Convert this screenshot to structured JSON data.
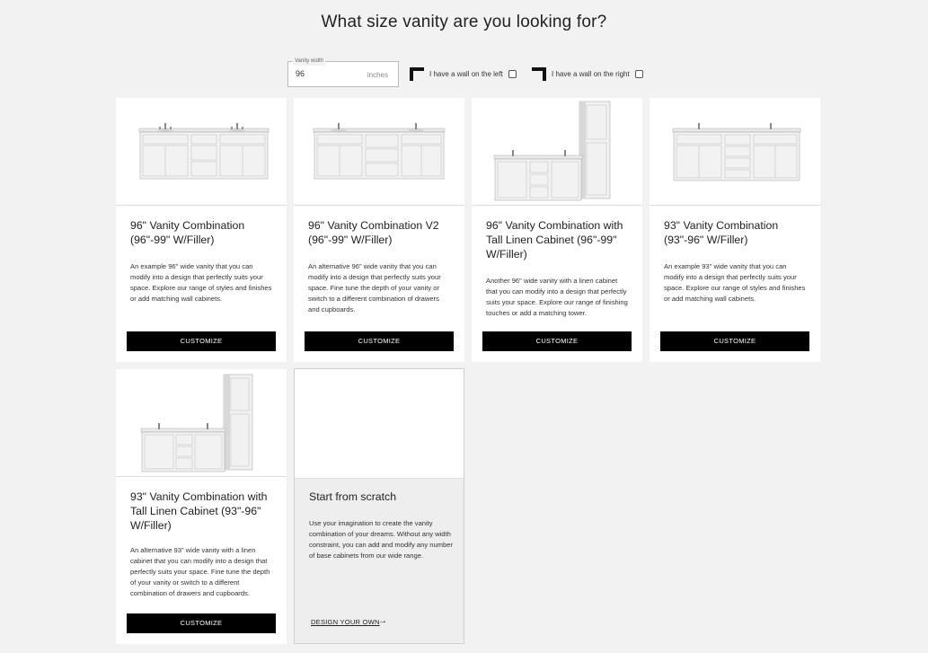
{
  "page": {
    "title": "What size vanity are you looking for?"
  },
  "controls": {
    "width_label": "Vanity width",
    "width_value": "96",
    "width_unit": "inches",
    "wall_left_label": "I have a wall on the left",
    "wall_left_checked": false,
    "wall_right_label": "I have a wall on the right",
    "wall_right_checked": false
  },
  "cards": [
    {
      "title": "96\" Vanity Combination (96\"-99\" W/Filler)",
      "description": "An example 96\" wide vanity that you can modify into a design that perfectly suits your space. Explore our range of styles and finishes or add matching wall cabinets.",
      "button": "CUSTOMIZE",
      "image": "double-vanity-image"
    },
    {
      "title": "96\" Vanity Combination V2 (96\"-99\" W/Filler)",
      "description": "An alternative 96\" wide vanity that you can modify into a design that perfectly suits your space. Fine tune the depth of your vanity or switch to a different combination of drawers and cupboards.",
      "button": "CUSTOMIZE",
      "image": "double-vanity-image"
    },
    {
      "title": "96\" Vanity Combination with Tall Linen Cabinet (96\"-99\" W/Filler)",
      "description": "Another 96\" wide vanity with a linen cabinet that you can modify into a design that perfectly suits your space. Explore our range of finishing touches or add a matching tower.",
      "button": "CUSTOMIZE",
      "image": "vanity-with-linen-tower-image"
    },
    {
      "title": "93\" Vanity Combination (93\"-96\" W/Filler)",
      "description": "An example 93\" wide vanity that you can modify into a design that perfectly suits your space. Explore our range of styles and finishes or add matching wall cabinets.",
      "button": "CUSTOMIZE",
      "image": "double-vanity-image"
    },
    {
      "title": "93\" Vanity Combination with Tall Linen Cabinet (93\"-96\" W/Filler)",
      "description": "An alternative 93\" wide vanity with a linen cabinet that you can modify into a design that perfectly suits your space. Fine tune the depth of your vanity or switch to a different combination of drawers and cupboards.",
      "button": "CUSTOMIZE",
      "image": "vanity-with-linen-tower-image"
    }
  ],
  "scratch": {
    "title": "Start from scratch",
    "description": "Use your imagination to create the vanity combination of your dreams. Without any width constraint, you can add and modify any number of base cabinets from our wide range.",
    "link": "DESIGN YOUR OWN",
    "link_icon": "arrow-right-icon"
  },
  "colors": {
    "button_bg": "#000000",
    "page_bg": "#f2f2f2",
    "card_bg": "#ffffff",
    "scratch_bg": "#eeeeee"
  }
}
